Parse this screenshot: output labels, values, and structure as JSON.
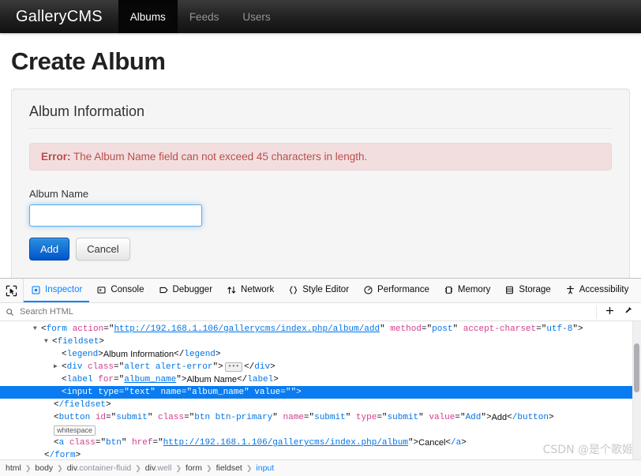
{
  "navbar": {
    "brand": "GalleryCMS",
    "items": [
      {
        "label": "Albums",
        "active": true
      },
      {
        "label": "Feeds",
        "active": false
      },
      {
        "label": "Users",
        "active": false
      }
    ]
  },
  "page": {
    "title": "Create Album",
    "legend": "Album Information",
    "alert": {
      "strong": "Error:",
      "message": "The Album Name field can not exceed 45 characters in length."
    },
    "form": {
      "label": "Album Name",
      "input_value": "",
      "input_placeholder": "",
      "submit_label": "Add",
      "cancel_label": "Cancel"
    }
  },
  "devtools": {
    "tabs": [
      {
        "label": "Inspector",
        "icon": "inspector-icon",
        "active": true
      },
      {
        "label": "Console",
        "icon": "console-icon",
        "active": false
      },
      {
        "label": "Debugger",
        "icon": "debugger-icon",
        "active": false
      },
      {
        "label": "Network",
        "icon": "network-icon",
        "active": false
      },
      {
        "label": "Style Editor",
        "icon": "style-editor-icon",
        "active": false
      },
      {
        "label": "Performance",
        "icon": "performance-icon",
        "active": false
      },
      {
        "label": "Memory",
        "icon": "memory-icon",
        "active": false
      },
      {
        "label": "Storage",
        "icon": "storage-icon",
        "active": false
      },
      {
        "label": "Accessibility",
        "icon": "accessibility-icon",
        "active": false
      }
    ],
    "search": {
      "placeholder": "Search HTML",
      "value": ""
    },
    "dom": {
      "form_tag": "form",
      "form_attr_action": "action",
      "form_url": "http://192.168.1.106/gallerycms/index.php/album/add",
      "form_attr_method": "method",
      "form_method": "post",
      "form_attr_charset": "accept-charset",
      "form_charset": "utf-8",
      "fieldset_tag": "fieldset",
      "legend_tag": "legend",
      "legend_text": "Album Information",
      "div_tag": "div",
      "div_attr_class": "class",
      "div_class": "alert alert-error",
      "label_tag": "label",
      "label_attr_for": "for",
      "label_for": "album_name",
      "label_text": "Album Name",
      "input_tag": "input",
      "input_attr_type": "type",
      "input_type": "text",
      "input_attr_name": "name",
      "input_name": "album_name",
      "input_attr_value": "value",
      "input_value": "",
      "fieldset_close": "/fieldset",
      "button_tag": "button",
      "button_attr_id": "id",
      "button_id": "submit",
      "button_attr_class": "class",
      "button_class": "btn btn-primary",
      "button_attr_name": "name",
      "button_name": "submit",
      "button_attr_type": "type",
      "button_type": "submit",
      "button_attr_value": "value",
      "button_value": "Add",
      "button_text": "Add",
      "button_close": "/button",
      "whitespace_badge": "whitespace",
      "a_tag": "a",
      "a_attr_class": "class",
      "a_class": "btn",
      "a_attr_href": "href",
      "a_href": "http://192.168.1.106/gallerycms/index.php/album",
      "a_text": "Cancel",
      "a_close": "/a",
      "form_close": "/form"
    },
    "breadcrumb": [
      {
        "tag": "html",
        "cls": "",
        "selected": false
      },
      {
        "tag": "body",
        "cls": "",
        "selected": false
      },
      {
        "tag": "div",
        "cls": ".container-fluid",
        "selected": false
      },
      {
        "tag": "div",
        "cls": ".well",
        "selected": false
      },
      {
        "tag": "form",
        "cls": "",
        "selected": false
      },
      {
        "tag": "fieldset",
        "cls": "",
        "selected": false
      },
      {
        "tag": "input",
        "cls": "",
        "selected": true
      }
    ]
  },
  "watermark": "CSDN @是个歌姬",
  "colors": {
    "accent": "#0a84ff",
    "primary_button": "#0055cc",
    "error_text": "#b94a48",
    "error_bg": "#f2dede",
    "navbar_bg": "#222222"
  }
}
